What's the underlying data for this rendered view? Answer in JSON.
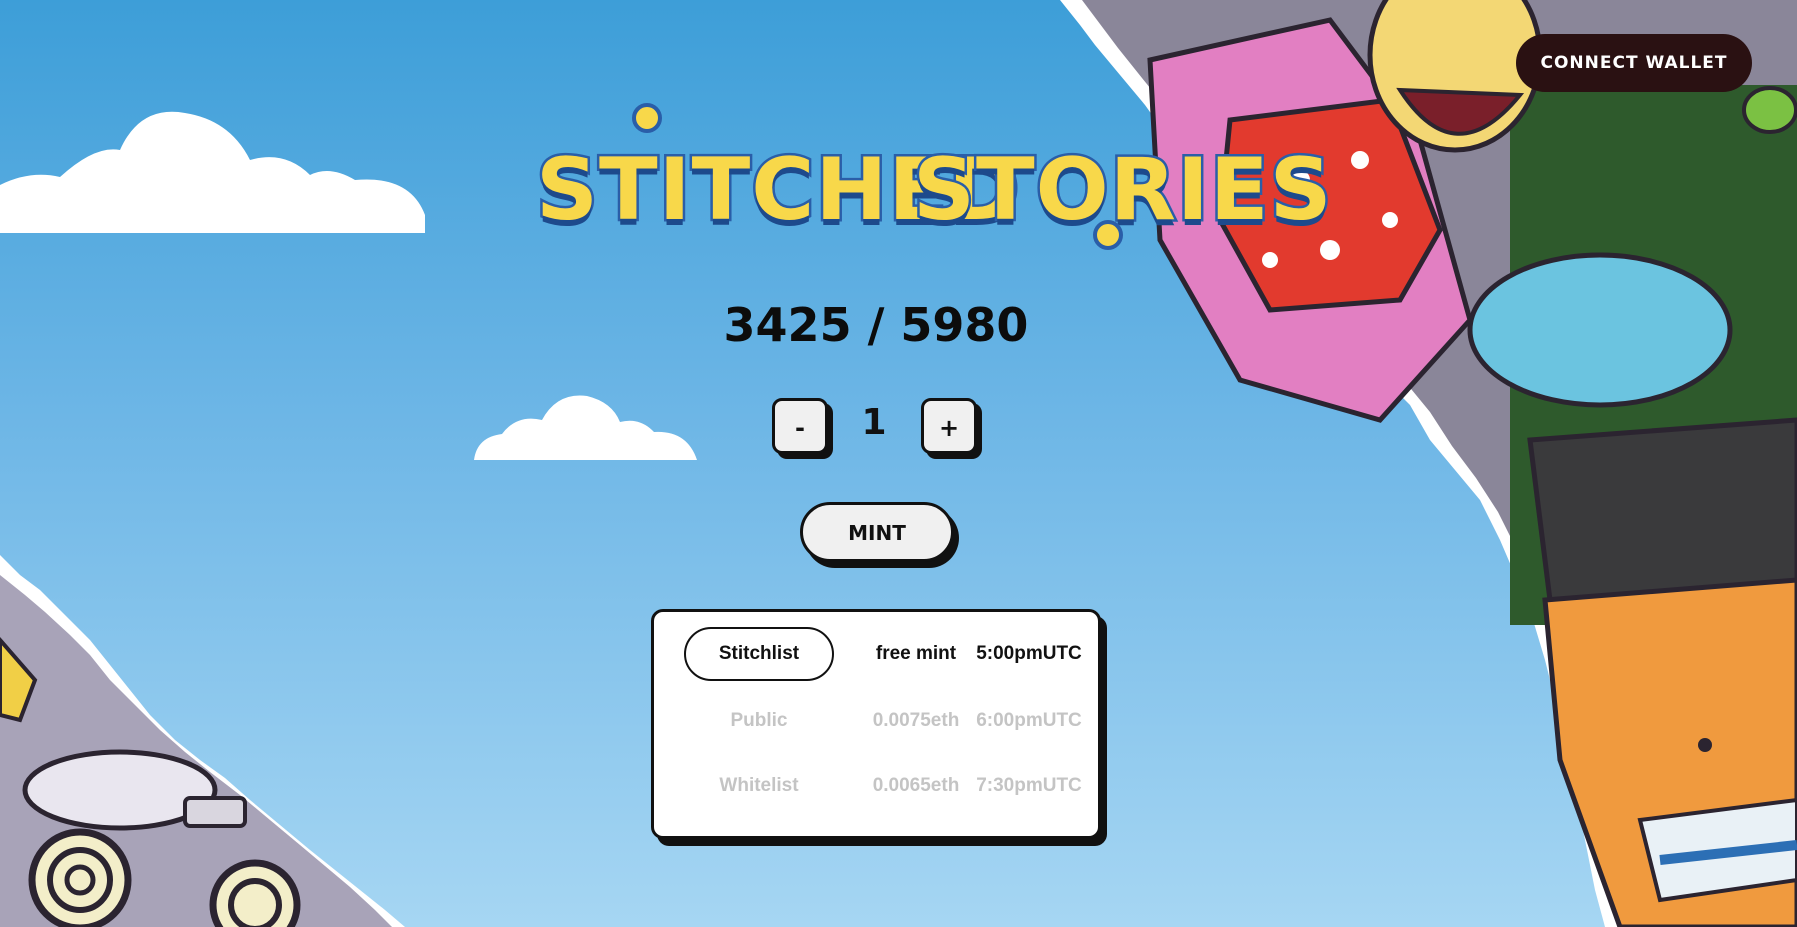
{
  "header": {
    "connect_wallet_label": "CONNECT WALLET"
  },
  "logo": {
    "word1": "STITCHED",
    "word2": "STORIES"
  },
  "supply": {
    "minted": 3425,
    "total": 5980,
    "text": "3425 / 5980"
  },
  "stepper": {
    "minus_label": "-",
    "quantity": "1",
    "plus_label": "+"
  },
  "mint": {
    "label": "MINT"
  },
  "phases": [
    {
      "name": "Stitchlist",
      "price": "free mint",
      "time": "5:00pmUTC",
      "active": true
    },
    {
      "name": "Public",
      "price": "0.0075eth",
      "time": "6:00pmUTC",
      "active": false
    },
    {
      "name": "Whitelist",
      "price": "0.0065eth",
      "time": "7:30pmUTC",
      "active": false
    }
  ],
  "colors": {
    "sky_top": "#3d9ed8",
    "sky_bottom": "#a6d6f3",
    "logo_yellow": "#f8d84a",
    "logo_outline": "#2a5ea8",
    "connect_button_bg": "#2a1112"
  }
}
